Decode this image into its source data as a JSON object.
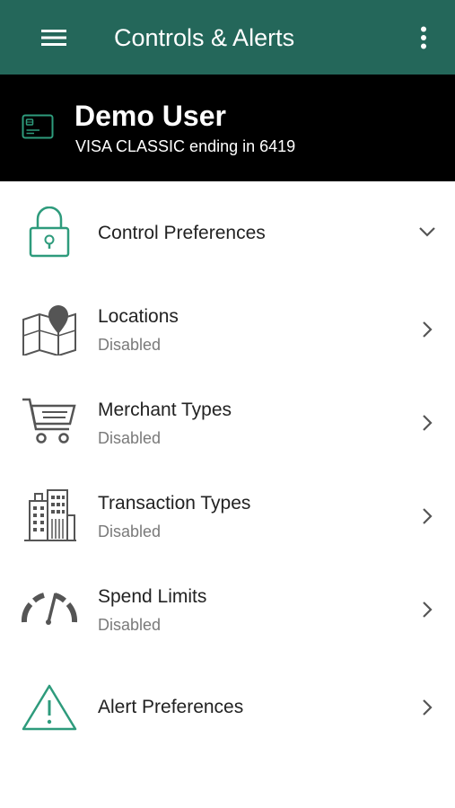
{
  "app_bar": {
    "title": "Controls & Alerts",
    "background": "#24675a",
    "menu_icon": "hamburger-menu-icon",
    "overflow_icon": "more-vertical-icon"
  },
  "card": {
    "user_name": "Demo User",
    "description": "VISA CLASSIC ending in 6419",
    "icon": "credit-card-icon",
    "icon_color": "#2e9b7c"
  },
  "control_preferences": {
    "label": "Control Preferences",
    "icon": "padlock-icon",
    "chevron": "chevron-down-icon"
  },
  "controls": [
    {
      "label": "Locations",
      "status": "Disabled",
      "icon": "map-pin-icon"
    },
    {
      "label": "Merchant Types",
      "status": "Disabled",
      "icon": "shopping-cart-icon"
    },
    {
      "label": "Transaction Types",
      "status": "Disabled",
      "icon": "buildings-icon"
    },
    {
      "label": "Spend Limits",
      "status": "Disabled",
      "icon": "speedometer-icon"
    }
  ],
  "alert_preferences": {
    "label": "Alert Preferences",
    "icon": "warning-triangle-icon"
  },
  "accent_color": "#2e9b7c"
}
